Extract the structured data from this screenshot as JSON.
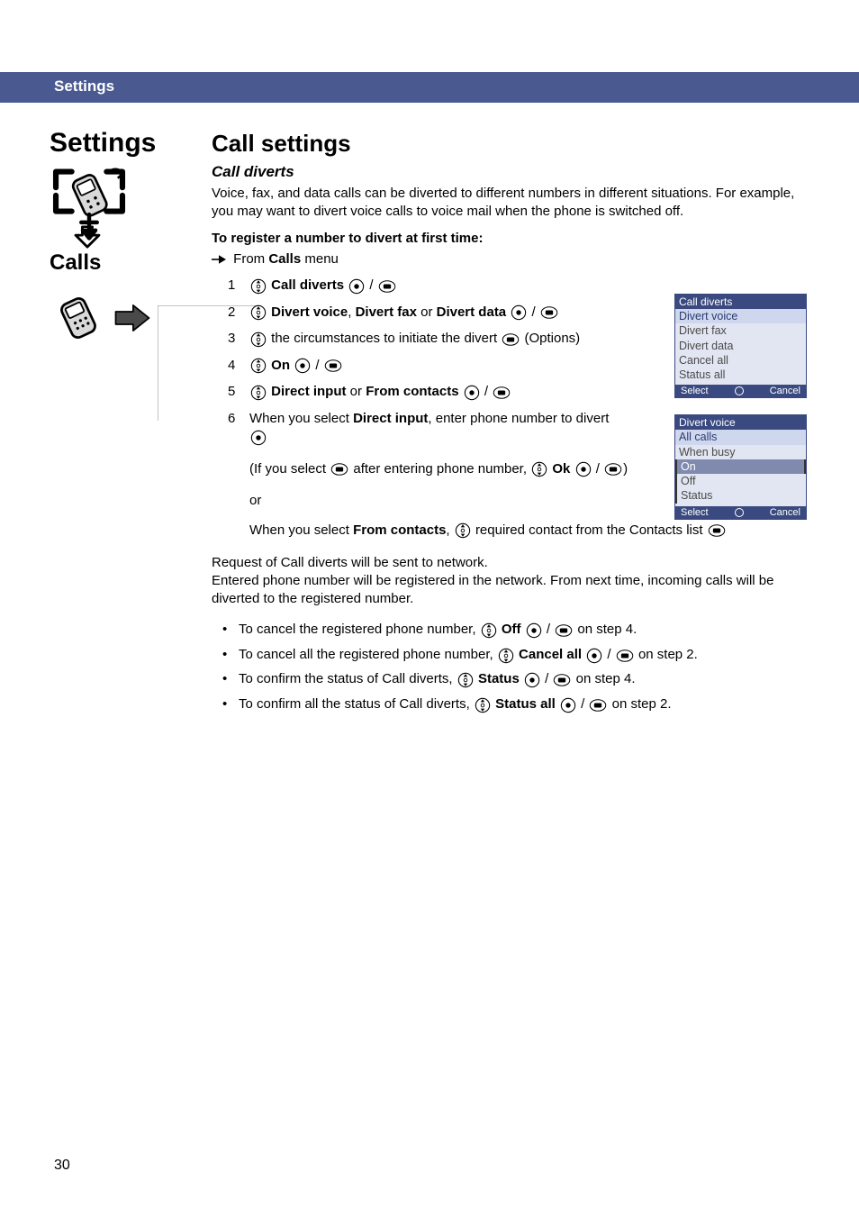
{
  "header": {
    "section": "Settings"
  },
  "left": {
    "title": "Settings",
    "subsection": "Calls"
  },
  "main": {
    "h1": "Call settings",
    "h2": "Call diverts",
    "intro": "Voice, fax, and data calls can be diverted to different numbers in different situations. For example, you may want to divert voice calls to voice mail when the phone is switched off.",
    "register_heading": "To register a number to divert at first time:",
    "from_pre": "From ",
    "from_bold": "Calls",
    "from_post": " menu",
    "steps": {
      "s1_b": "Call diverts",
      "s2_b1": "Divert voice",
      "s2_sep1": ", ",
      "s2_b2": "Divert fax",
      "s2_sep2": " or ",
      "s2_b3": "Divert data",
      "s3_text": " the circumstances to initiate the divert ",
      "s3_opt": " (Options)",
      "s4_b": "On",
      "s5_b1": "Direct input",
      "s5_sep": " or ",
      "s5_b2": "From contacts",
      "s6_pre": "When you select ",
      "s6_b": "Direct input",
      "s6_post": ", enter phone number to divert "
    },
    "if_line_pre": "(If you select ",
    "if_line_mid": " after entering phone number, ",
    "if_ok": "Ok",
    "if_line_end": ")",
    "or": "or",
    "from_contacts_pre": "When you select ",
    "from_contacts_b": "From contacts",
    "from_contacts_mid": ", ",
    "from_contacts_post": " required contact from the Contacts list ",
    "request_para": "Request of Call diverts will be sent to network.\nEntered phone number will be registered in the network. From next time, incoming calls will be diverted to the registered number.",
    "bullets": {
      "b1_pre": "To cancel the registered phone number, ",
      "b1_bold": "Off",
      "b1_post": " on step 4.",
      "b2_pre": "To cancel all the registered phone number, ",
      "b2_bold": "Cancel all",
      "b2_post": " on step 2.",
      "b3_pre": "To confirm the status of Call diverts, ",
      "b3_bold": "Status",
      "b3_post": " on step 4.",
      "b4_pre": "To confirm all the status of Call diverts, ",
      "b4_bold": "Status all",
      "b4_post": " on step 2."
    },
    "slash": " / "
  },
  "screens": {
    "s1": {
      "title": "Call diverts",
      "rows": [
        "Divert voice",
        "Divert fax",
        "Divert data",
        "Cancel all",
        "Status all"
      ],
      "soft_left": "Select",
      "soft_right": "Cancel"
    },
    "s2": {
      "title": "Divert voice",
      "rows": [
        "All calls",
        "When busy",
        "On",
        "Off",
        "Status"
      ],
      "soft_left": "Select",
      "soft_right": "Cancel"
    }
  },
  "page_number": "30"
}
